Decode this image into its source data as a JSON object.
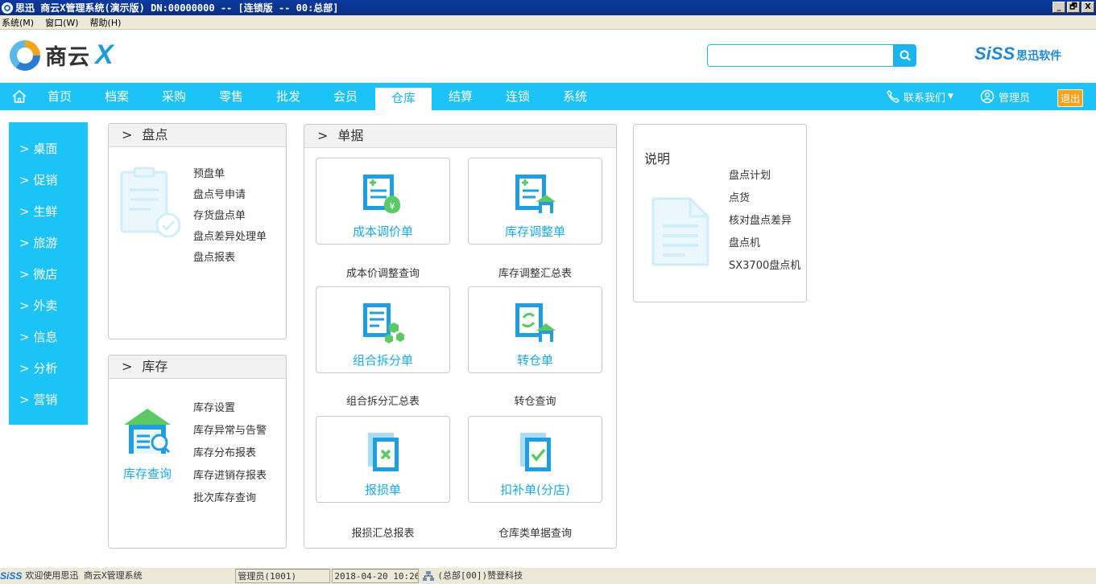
{
  "window": {
    "title": "思迅 商云X管理系统(演示版) DN:00000000 -- [连锁版 -- 00:总部]",
    "buttons": [
      "_",
      "🗗",
      "X"
    ]
  },
  "menubar": [
    "系统(M)",
    "窗口(W)",
    "帮助(H)"
  ],
  "header": {
    "logo_name": "商云",
    "logo_x": "X",
    "search_placeholder": "",
    "brand_prefix": "SiSS",
    "brand_suffix": "思迅软件"
  },
  "nav": {
    "items": [
      "首页",
      "档案",
      "采购",
      "零售",
      "批发",
      "会员",
      "仓库",
      "结算",
      "连锁",
      "系统"
    ],
    "active": "仓库",
    "contact": "联系我们",
    "user": "管理员",
    "logout": "退出"
  },
  "sidebar": [
    "> 桌面",
    "> 促销",
    "> 生鲜",
    "> 旅游",
    "> 微店",
    "> 外卖",
    "> 信息",
    "> 分析",
    "> 营销"
  ],
  "panels": {
    "inventory_check": {
      "title": "盘点",
      "links": [
        "预盘单",
        "盘点号申请",
        "存货盘点单",
        "盘点差异处理单",
        "盘点报表"
      ]
    },
    "stock": {
      "title": "库存",
      "feature_label": "库存查询",
      "links": [
        "库存设置",
        "库存异常与告警",
        "库存分布报表",
        "库存进销存报表",
        "批次库存查询"
      ]
    },
    "documents": {
      "title": "单据",
      "cards": [
        {
          "label": "成本调价单",
          "sublink": "成本价调整查询",
          "icon": "cost-adjust-icon"
        },
        {
          "label": "库存调整单",
          "sublink": "库存调整汇总表",
          "icon": "stock-adjust-icon"
        },
        {
          "label": "组合拆分单",
          "sublink": "组合拆分汇总表",
          "icon": "combine-split-icon"
        },
        {
          "label": "转仓单",
          "sublink": "转仓查询",
          "icon": "transfer-icon"
        },
        {
          "label": "报损单",
          "sublink": "报损汇总报表",
          "icon": "loss-report-icon"
        },
        {
          "label": "扣补单(分店)",
          "sublink": "仓库类单据查询",
          "icon": "deduct-icon"
        }
      ]
    },
    "notes": {
      "title": "说明",
      "links": [
        "盘点计划",
        "点货",
        "核对盘点差异",
        "盘点机",
        "SX3700盘点机"
      ]
    }
  },
  "statusbar": {
    "brand": "SiSS",
    "welcome": "欢迎使用思迅 商云X管理系统",
    "user": "管理员(1001)",
    "datetime": "2018-04-20 10:26",
    "branch": "(总部[00])赞登科技"
  },
  "colors": {
    "primary": "#1bc3f6",
    "accent_text": "#1aa9e1",
    "logout": "#f7a21b"
  }
}
